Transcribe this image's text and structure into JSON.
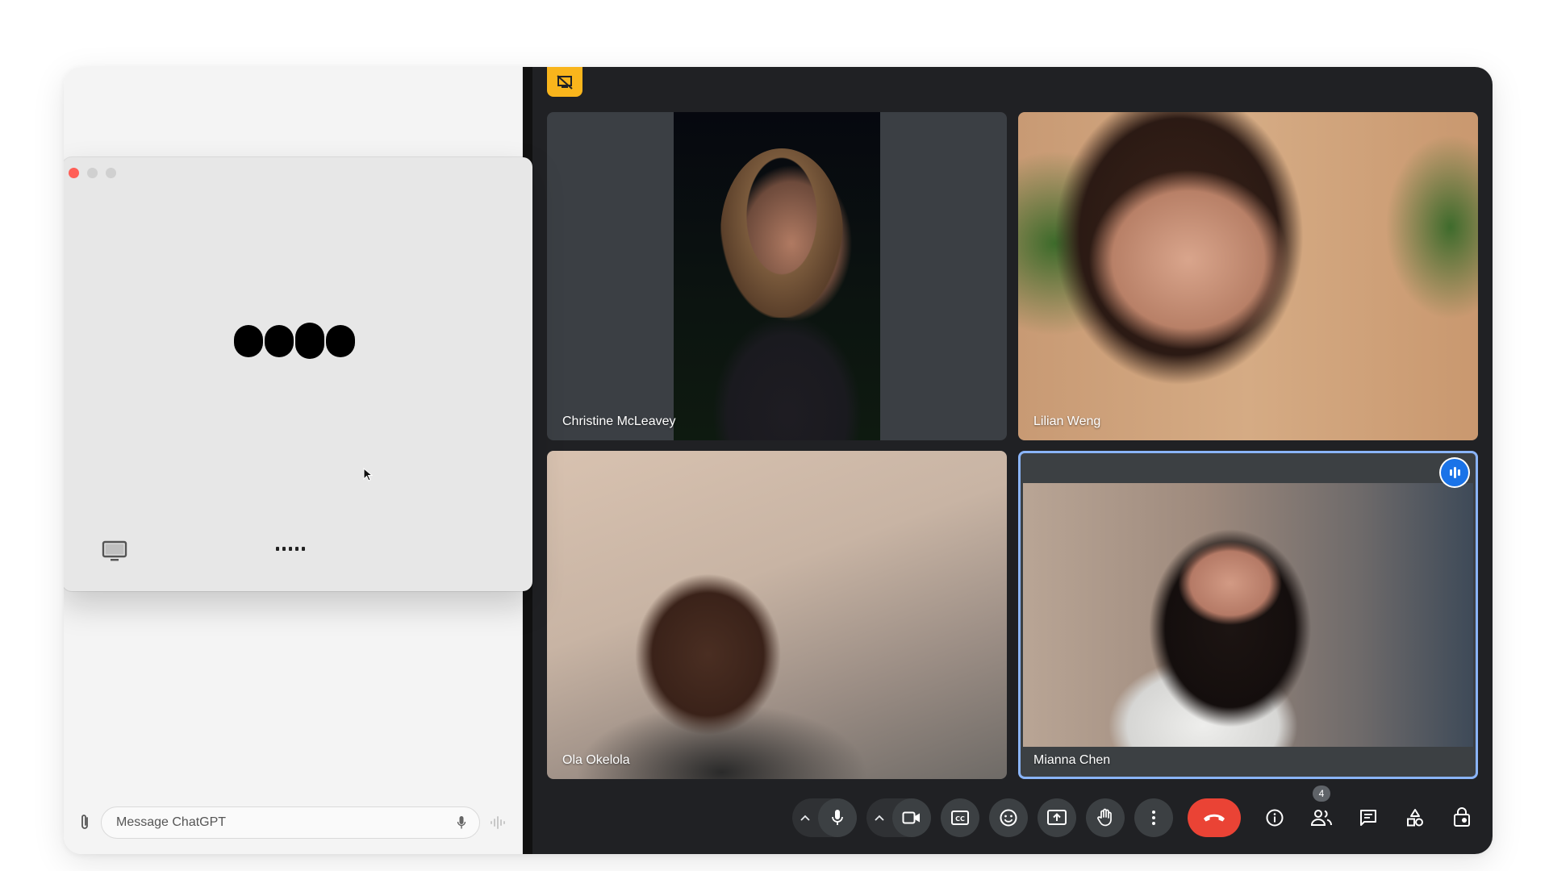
{
  "chatgpt": {
    "composer": {
      "placeholder": "Message ChatGPT"
    }
  },
  "meet": {
    "participants": [
      {
        "name": "Christine McLeavey",
        "speaking": false
      },
      {
        "name": "Lilian Weng",
        "speaking": false
      },
      {
        "name": "Ola Okelola",
        "speaking": false
      },
      {
        "name": "Mianna Chen",
        "speaking": true
      }
    ],
    "people_count": "4"
  },
  "icons": {
    "recording_badge": "no-screen-share-icon",
    "speaking_indicator": "audio-level-icon"
  },
  "colors": {
    "meet_background": "#202124",
    "end_call": "#ea4335",
    "active_speaker": "#8ab4f8",
    "badge": "#f9b51c"
  }
}
